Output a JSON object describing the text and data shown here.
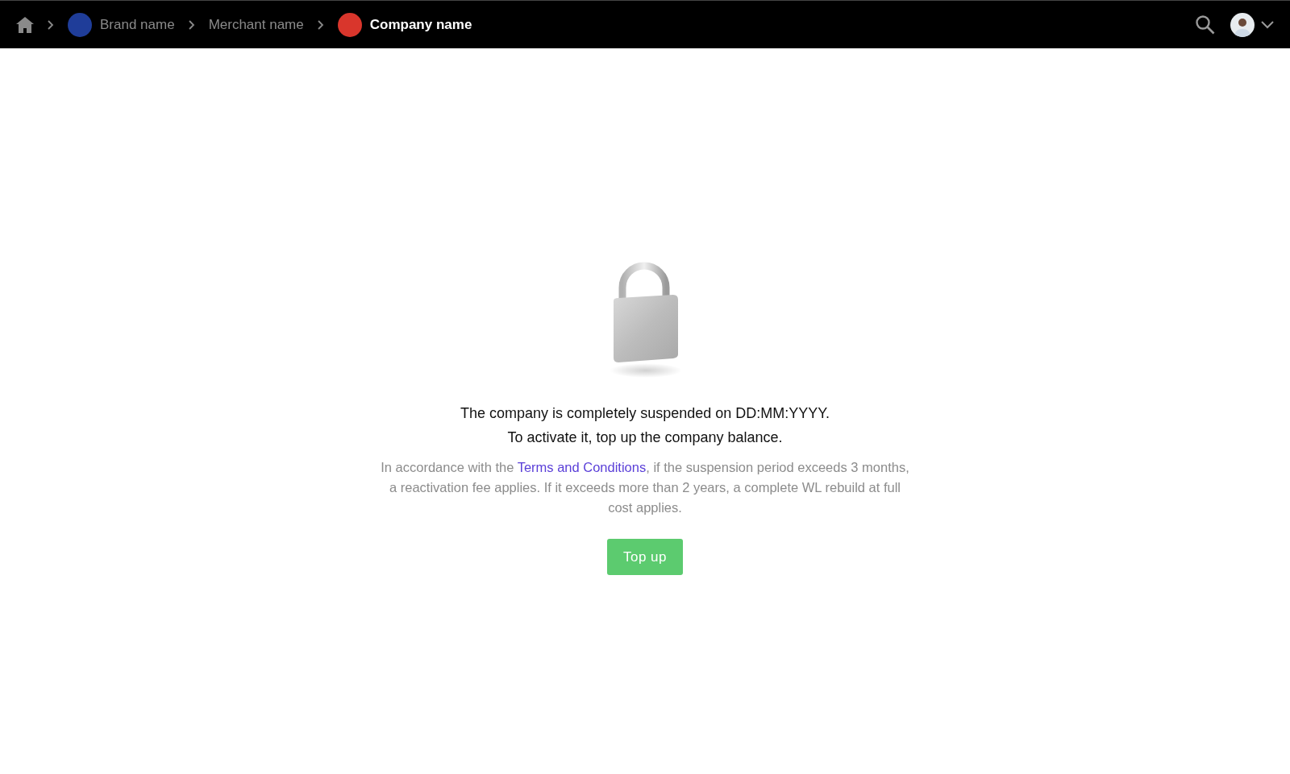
{
  "breadcrumbs": [
    {
      "kind": "home",
      "selected": false
    },
    {
      "kind": "logo",
      "label": "Brand name",
      "color": "#1f3d99",
      "selected": false
    },
    {
      "kind": "text",
      "label": "Merchant name",
      "selected": false
    },
    {
      "kind": "logo",
      "label": "Company name",
      "color": "#d9362c",
      "selected": true
    }
  ],
  "notice": {
    "title": [
      "The company is completely suspended on DD:MM:YYYY.",
      "To activate it, top up the company balance."
    ],
    "paragraph": {
      "before": "In accordance with the ",
      "link": "Terms and Conditions",
      "after": ", if the suspension period exceeds 3 months, a reactivation fee applies. If it exceeds more than 2 years, a complete WL rebuild at full cost applies."
    },
    "button": "Top up"
  }
}
